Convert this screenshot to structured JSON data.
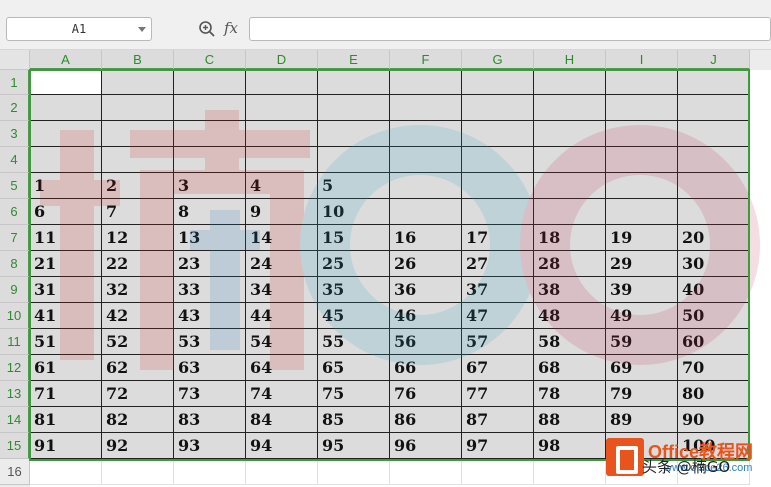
{
  "formula_bar": {
    "name_box": "A1",
    "fx_label": "fx",
    "formula_value": ""
  },
  "columns": [
    "A",
    "B",
    "C",
    "D",
    "E",
    "F",
    "G",
    "H",
    "I",
    "J"
  ],
  "rows": [
    "1",
    "2",
    "3",
    "4",
    "5",
    "6",
    "7",
    "8",
    "9",
    "10",
    "11",
    "12",
    "13",
    "14",
    "15",
    "16"
  ],
  "cells": [
    [
      "",
      "",
      "",
      "",
      "",
      "",
      "",
      "",
      "",
      ""
    ],
    [
      "",
      "",
      "",
      "",
      "",
      "",
      "",
      "",
      "",
      ""
    ],
    [
      "",
      "",
      "",
      "",
      "",
      "",
      "",
      "",
      "",
      ""
    ],
    [
      "",
      "",
      "",
      "",
      "",
      "",
      "",
      "",
      "",
      ""
    ],
    [
      "1",
      "2",
      "3",
      "4",
      "5",
      "",
      "",
      "",
      "",
      ""
    ],
    [
      "6",
      "7",
      "8",
      "9",
      "10",
      "",
      "",
      "",
      "",
      ""
    ],
    [
      "11",
      "12",
      "13",
      "14",
      "15",
      "16",
      "17",
      "18",
      "19",
      "20"
    ],
    [
      "21",
      "22",
      "23",
      "24",
      "25",
      "26",
      "27",
      "28",
      "29",
      "30"
    ],
    [
      "31",
      "32",
      "33",
      "34",
      "35",
      "36",
      "37",
      "38",
      "39",
      "40"
    ],
    [
      "41",
      "42",
      "43",
      "44",
      "45",
      "46",
      "47",
      "48",
      "49",
      "50"
    ],
    [
      "51",
      "52",
      "53",
      "54",
      "55",
      "56",
      "57",
      "58",
      "59",
      "60"
    ],
    [
      "61",
      "62",
      "63",
      "64",
      "65",
      "66",
      "67",
      "68",
      "69",
      "70"
    ],
    [
      "71",
      "72",
      "73",
      "74",
      "75",
      "76",
      "77",
      "78",
      "79",
      "80"
    ],
    [
      "81",
      "82",
      "83",
      "84",
      "85",
      "86",
      "87",
      "88",
      "89",
      "90"
    ],
    [
      "91",
      "92",
      "93",
      "94",
      "95",
      "96",
      "97",
      "98",
      "99",
      "100"
    ]
  ],
  "watermark": "楠GO",
  "logo": {
    "title": "Office教程网",
    "subtitle": "www.office26.com",
    "overlay": "头条 @楠GO"
  },
  "colors": {
    "selection": "#3d9a3d",
    "header_text": "#2f8a2f",
    "logo_orange": "#e8541e"
  }
}
